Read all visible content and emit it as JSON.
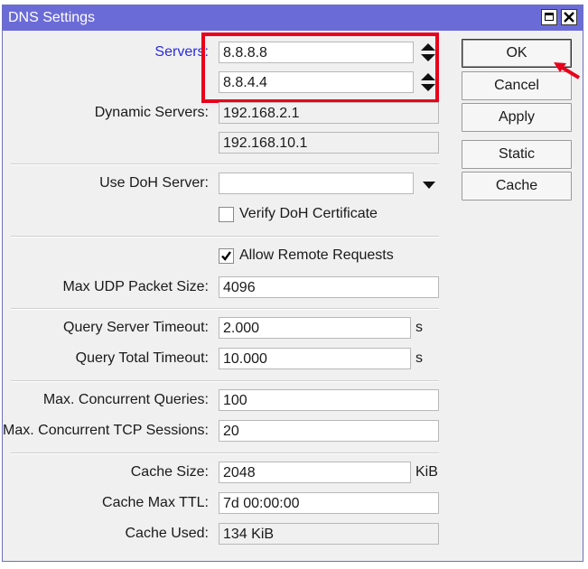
{
  "window": {
    "title": "DNS Settings"
  },
  "servers": {
    "label": "Servers:",
    "values": [
      "8.8.8.8",
      "8.8.4.4"
    ]
  },
  "dynamic_servers": {
    "label": "Dynamic Servers:",
    "values": [
      "192.168.2.1",
      "192.168.10.1"
    ]
  },
  "doh": {
    "label": "Use DoH Server:",
    "value": "",
    "verify_label": "Verify DoH Certificate",
    "verify_checked": false
  },
  "remote": {
    "label": "Allow Remote Requests",
    "checked": true
  },
  "max_udp": {
    "label": "Max UDP Packet Size:",
    "value": "4096"
  },
  "query_server_timeout": {
    "label": "Query Server Timeout:",
    "value": "2.000",
    "unit": "s"
  },
  "query_total_timeout": {
    "label": "Query Total Timeout:",
    "value": "10.000",
    "unit": "s"
  },
  "max_concurrent_queries": {
    "label": "Max. Concurrent Queries:",
    "value": "100"
  },
  "max_concurrent_tcp": {
    "label": "Max. Concurrent TCP Sessions:",
    "value": "20"
  },
  "cache_size": {
    "label": "Cache Size:",
    "value": "2048",
    "unit": "KiB"
  },
  "cache_max_ttl": {
    "label": "Cache Max TTL:",
    "value": "7d 00:00:00"
  },
  "cache_used": {
    "label": "Cache Used:",
    "value": "134 KiB"
  },
  "buttons": {
    "ok": "OK",
    "cancel": "Cancel",
    "apply": "Apply",
    "static": "Static",
    "cache": "Cache"
  },
  "icons": {
    "maximize": "maximize-icon",
    "close": "close-icon",
    "spin": "up-down-arrows-icon",
    "dropdown": "triangle-down-icon",
    "check": "checkmark-icon",
    "annotation_arrow": "red-arrow-icon"
  },
  "colors": {
    "titlebar": "#6b6bd8",
    "highlight": "#e8001c",
    "servers_label": "#2b2bd9"
  }
}
